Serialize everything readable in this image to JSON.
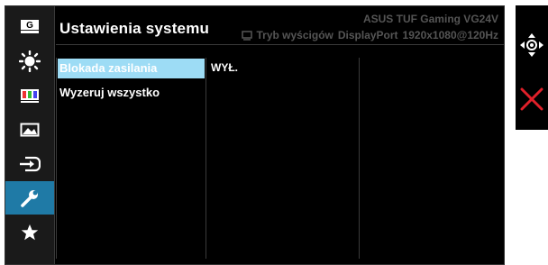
{
  "header": {
    "title": "Ustawienia systemu",
    "model": "ASUS TUF Gaming VG24V",
    "mode": "Tryb wyścigów",
    "input": "DisplayPort",
    "resolution": "1920x1080@120Hz"
  },
  "sidebar": {
    "items": [
      {
        "icon": "gameplus-icon",
        "label": "G"
      },
      {
        "icon": "brightness-icon"
      },
      {
        "icon": "color-icon"
      },
      {
        "icon": "image-icon"
      },
      {
        "icon": "input-select-icon"
      },
      {
        "icon": "wrench-icon"
      },
      {
        "icon": "star-icon"
      }
    ],
    "active_index": 5
  },
  "menu": {
    "items": [
      {
        "label": "Blokada zasilania",
        "selected": true
      },
      {
        "label": "Wyzeruj wszystko",
        "selected": false
      }
    ],
    "value": "WYŁ."
  },
  "nav": {
    "joystick_icon": "joystick-icon",
    "close_icon": "close-icon"
  },
  "colors": {
    "accent": "#1f7aa6",
    "selection": "#9ddcf5",
    "close": "#e0202a"
  }
}
